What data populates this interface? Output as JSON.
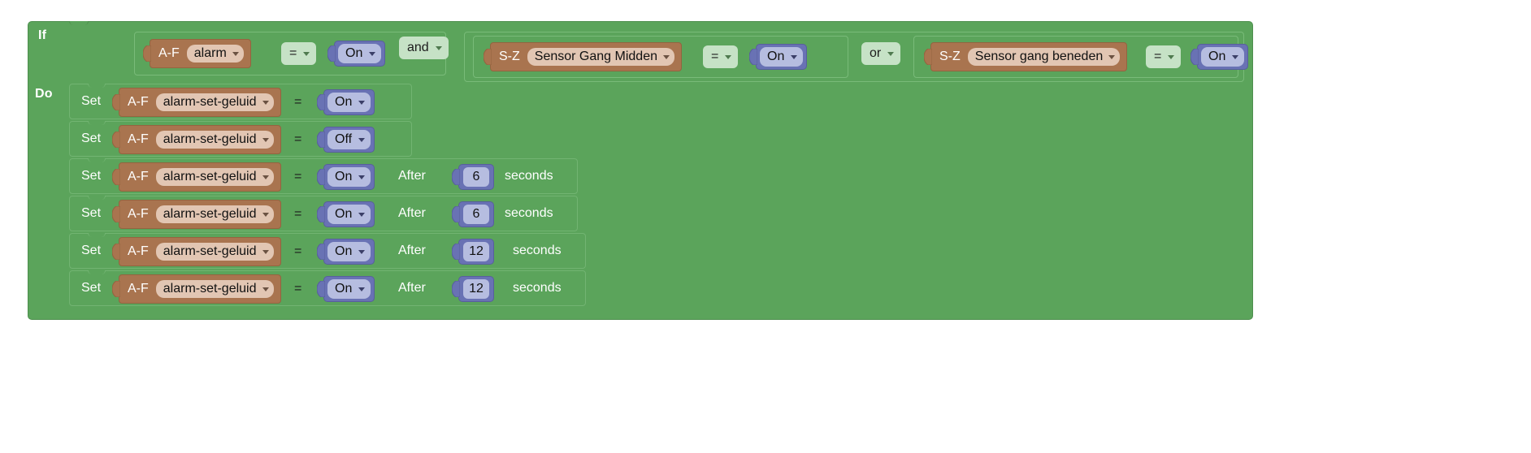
{
  "editor": {
    "type": "blockly-visual-program",
    "colors": {
      "control_block": "#5ba45b",
      "device_block": "#a9744f",
      "device_field": "#e2c6b3",
      "operator_pill": "#c6e2c6",
      "value_block": "#6972b4",
      "value_field": "#b6bde0",
      "canvas": "#ffffff"
    }
  },
  "if_block": {
    "if_label": "If",
    "do_label": "Do",
    "conditions": [
      {
        "prefix": "A-F",
        "entity": "alarm",
        "operator": "=",
        "value": "On"
      },
      {
        "prefix": "S-Z",
        "entity": "Sensor Gang Midden",
        "operator": "=",
        "value": "On"
      },
      {
        "prefix": "S-Z",
        "entity": "Sensor gang beneden",
        "operator": "=",
        "value": "On"
      }
    ],
    "logic_operators": [
      {
        "label": "and"
      },
      {
        "label": "or"
      }
    ],
    "statements": [
      {
        "set_label": "Set",
        "prefix": "A-F",
        "entity": "alarm-set-geluid",
        "operator": "=",
        "value": "On",
        "after_label": "",
        "delay": "",
        "seconds_label": ""
      },
      {
        "set_label": "Set",
        "prefix": "A-F",
        "entity": "alarm-set-geluid",
        "operator": "=",
        "value": "Off",
        "after_label": "",
        "delay": "",
        "seconds_label": ""
      },
      {
        "set_label": "Set",
        "prefix": "A-F",
        "entity": "alarm-set-geluid",
        "operator": "=",
        "value": "On",
        "after_label": "After",
        "delay": "6",
        "seconds_label": "seconds"
      },
      {
        "set_label": "Set",
        "prefix": "A-F",
        "entity": "alarm-set-geluid",
        "operator": "=",
        "value": "On",
        "after_label": "After",
        "delay": "6",
        "seconds_label": "seconds"
      },
      {
        "set_label": "Set",
        "prefix": "A-F",
        "entity": "alarm-set-geluid",
        "operator": "=",
        "value": "On",
        "after_label": "After",
        "delay": "12",
        "seconds_label": "seconds"
      },
      {
        "set_label": "Set",
        "prefix": "A-F",
        "entity": "alarm-set-geluid",
        "operator": "=",
        "value": "On",
        "after_label": "After",
        "delay": "12",
        "seconds_label": "seconds"
      }
    ]
  }
}
